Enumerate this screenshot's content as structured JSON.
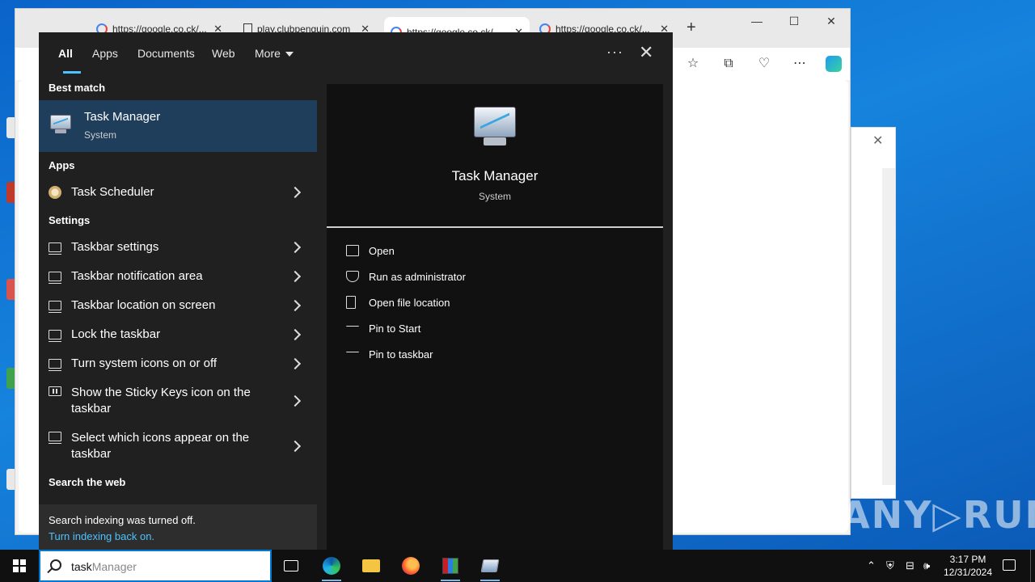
{
  "browser": {
    "tabs": [
      {
        "label": "https://google.co.ck/..."
      },
      {
        "label": "play.clubpenguin.com"
      },
      {
        "label": "https://google.co.ck/..."
      },
      {
        "label": "https://google.co.ck/..."
      }
    ],
    "new_tab": "+",
    "window_controls": {
      "minimize": "—",
      "maximize": "☐",
      "close": "✕"
    }
  },
  "search_panel": {
    "filters": [
      "All",
      "Apps",
      "Documents",
      "Web",
      "More"
    ],
    "more_menu": "···",
    "close": "✕",
    "best_match_heading": "Best match",
    "best_match": {
      "title": "Task Manager",
      "subtitle": "System"
    },
    "apps_heading": "Apps",
    "apps": [
      {
        "label": "Task Scheduler"
      }
    ],
    "settings_heading": "Settings",
    "settings": [
      {
        "label": "Taskbar settings",
        "icon": "monitor-icon"
      },
      {
        "label": "Taskbar notification area",
        "icon": "monitor-icon"
      },
      {
        "label": "Taskbar location on screen",
        "icon": "monitor-icon"
      },
      {
        "label": "Lock the taskbar",
        "icon": "monitor-icon"
      },
      {
        "label": "Turn system icons on or off",
        "icon": "monitor-icon"
      },
      {
        "label": "Show the Sticky Keys icon on the taskbar",
        "icon": "keyboard-icon"
      },
      {
        "label": "Select which icons appear on the taskbar",
        "icon": "monitor-icon"
      }
    ],
    "web_heading": "Search the web",
    "notice": {
      "text": "Search indexing was turned off.",
      "link": "Turn indexing back on."
    },
    "preview": {
      "title": "Task Manager",
      "subtitle": "System",
      "actions": [
        "Open",
        "Run as administrator",
        "Open file location",
        "Pin to Start",
        "Pin to taskbar"
      ]
    }
  },
  "taskbar": {
    "search_typed": "task",
    "search_hint": "Manager",
    "clock_time": "3:17 PM",
    "clock_date": "12/31/2024"
  },
  "watermark": "ANY▷RUN",
  "colors": {
    "accent": "#4cc2ff",
    "selection": "#1e3e5c",
    "panel_bg": "#202020"
  }
}
